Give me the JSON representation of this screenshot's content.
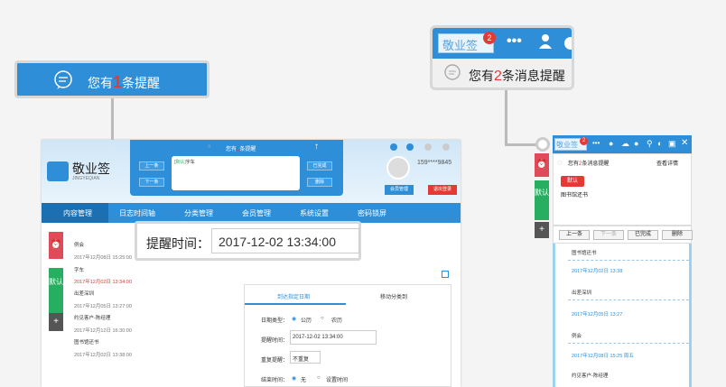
{
  "callout_main": {
    "prefix": "您有",
    "count": "1",
    "suffix": "条提醒"
  },
  "callout_tr": {
    "app_tag": "敬业签",
    "badge": "2",
    "prefix": "您有",
    "count": "2",
    "suffix": "条消息提醒"
  },
  "callout_time": {
    "label": "提醒时间：",
    "value": "2017-12-02 13:34:00"
  },
  "app": {
    "brand": "敬业签",
    "brand_sub": "JINGYEQIAN",
    "phone": "159****9845",
    "popup": {
      "prefix": "您有",
      "count": "1",
      "suffix": "条提醒",
      "prev": "上一条",
      "next": "下一条",
      "done": "已完成",
      "delete": "删除",
      "text_tag": "[默认]",
      "text": "字车"
    },
    "member_button": "会员管理",
    "logout_button": "退出登录",
    "nav": [
      "内容管理",
      "日志时间轴",
      "分类管理",
      "会员管理",
      "系统设置",
      "密码锁屏"
    ],
    "side": {
      "default": "默认",
      "add": "+"
    },
    "list": [
      {
        "title": "例会",
        "date": "2017年12月08日 15:25:00",
        "red": false
      },
      {
        "title": "字车",
        "date": "2017年12月02日 13:34:00",
        "red": true
      },
      {
        "title": "出差深圳",
        "date": "2017年12月05日 13:27:00",
        "red": false
      },
      {
        "title": "约见客户-陈经理",
        "date": "2017年12月12日 16:30:00",
        "red": false
      },
      {
        "title": "图书馆还书",
        "date": "2017年12月02日 13:38:00",
        "red": false
      }
    ],
    "form": {
      "tab1": "到达指定日期",
      "tab2": "移动分类到",
      "date_type_label": "日期类型：",
      "gregorian": "公历",
      "lunar": "农历",
      "remind_label": "提醒时间：",
      "remind_value": "2017-12-02 13:34:00",
      "repeat_label": "重复提醒：",
      "repeat_value": "不重复",
      "end_label": "结束时间：",
      "end_none": "无",
      "end_set": "设置时间"
    }
  },
  "right_panel": {
    "tag": "敬业签",
    "badge": "2",
    "msg_prefix": "您有",
    "msg_count": "2",
    "msg_suffix": "条消息提醒",
    "details": "查看详情",
    "default_tag": "默认",
    "note": "图书馆还书",
    "side_default": "默认",
    "side_add": "+",
    "buttons": [
      "上一条",
      "下一条",
      "已完成",
      "删除"
    ],
    "timeline": [
      {
        "title": "图书馆还书",
        "date": "2017年12月02日 13:38"
      },
      {
        "title": "出差深圳",
        "date": "2017年12月05日 13:27"
      },
      {
        "title": "例会",
        "date": "2017年12月08日 15:25 周五"
      },
      {
        "title": "约见客户-陈经理",
        "date": ""
      }
    ]
  },
  "colors": {
    "primary": "#2e8fd8",
    "alert": "#e53935",
    "green": "#27ae60",
    "alarm": "#e04b5a",
    "dark": "#555555"
  }
}
